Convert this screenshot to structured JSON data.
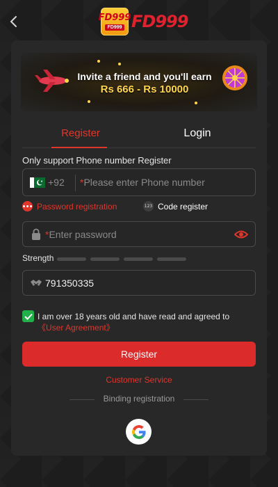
{
  "header": {
    "back_icon": "chevron-left-icon",
    "logo_badge_text": "FD999",
    "logo_badge_sub": "FD999",
    "logo_text": "FD999"
  },
  "banner": {
    "line1": "Invite a friend and you'll earn",
    "line2": "Rs 666 - Rs 10000"
  },
  "tabs": [
    {
      "label": "Register",
      "active": true
    },
    {
      "label": "Login",
      "active": false
    }
  ],
  "form": {
    "hint": "Only support Phone number Register",
    "country_code": "+92",
    "phone_placeholder": "Please enter Phone number",
    "required_mark": "*",
    "mode_password": "Password registration",
    "mode_code_icon": "123",
    "mode_code": "Code register",
    "password_placeholder": "Enter password",
    "strength_label": "Strength",
    "invite_code": "791350335",
    "agree_text": "I am over 18 years old and have read and agreed to ",
    "agree_link": "《User Agreement》",
    "register_button": "Register",
    "customer_service": "Customer Service",
    "binding_label": "Binding registration"
  },
  "colors": {
    "accent": "#e0362c",
    "background": "#1c1c1c",
    "card": "#282828",
    "checkbox": "#22b04b"
  }
}
